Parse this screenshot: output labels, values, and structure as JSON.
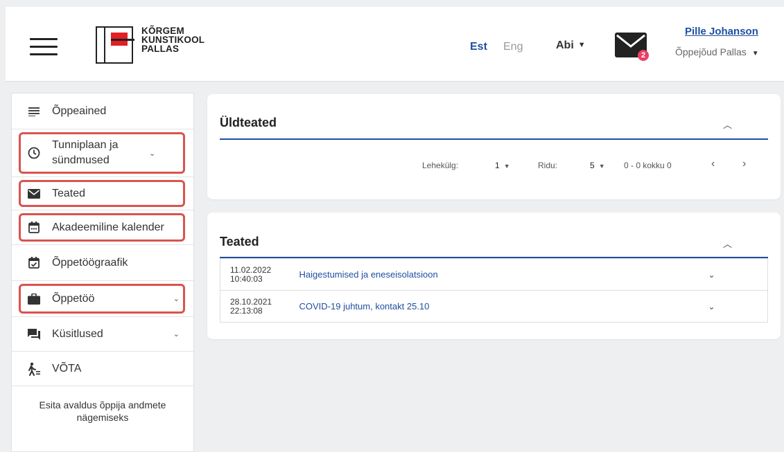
{
  "header": {
    "logo_lines": [
      "KÕRGEM",
      "KUNSTIKOOL",
      "PALLAS"
    ],
    "lang_est": "Est",
    "lang_eng": "Eng",
    "help_label": "Abi",
    "mail_badge": "2",
    "user_name": "Pille Johanson",
    "user_role": "Õppejõud Pallas"
  },
  "sidebar": {
    "items": [
      {
        "label": "Õppeained",
        "icon": "list-icon"
      },
      {
        "label": "Tunniplaan ja sündmused",
        "icon": "clock-icon"
      },
      {
        "label": "Teated",
        "icon": "mail-icon"
      },
      {
        "label": "Akadeemiline kalender",
        "icon": "calendar-icon"
      },
      {
        "label": "Õppetöögraafik",
        "icon": "calendar-check-icon"
      },
      {
        "label": "Õppetöö",
        "icon": "briefcase-icon"
      },
      {
        "label": "Küsitlused",
        "icon": "chat-icon"
      },
      {
        "label": "VÕTA",
        "icon": "person-walking-icon"
      }
    ],
    "footer_label": "Esita avaldus õppija andmete nägemiseks"
  },
  "general_notices": {
    "title": "Üldteated",
    "page_label": "Lehekülg:",
    "page_value": "1",
    "rows_label": "Ridu:",
    "rows_value": "5",
    "range_text": "0 - 0 kokku 0"
  },
  "notices": {
    "title": "Teated",
    "rows": [
      {
        "date": "11.02.2022",
        "time": "10:40:03",
        "title": "Haigestumised ja eneseisolatsioon"
      },
      {
        "date": "28.10.2021",
        "time": "22:13:08",
        "title": "COVID-19 juhtum, kontakt 25.10"
      }
    ]
  },
  "colors": {
    "accent": "#1f4fa0",
    "highlight": "#d9534f",
    "badge": "#e94164",
    "logo_red": "#e31e24"
  }
}
